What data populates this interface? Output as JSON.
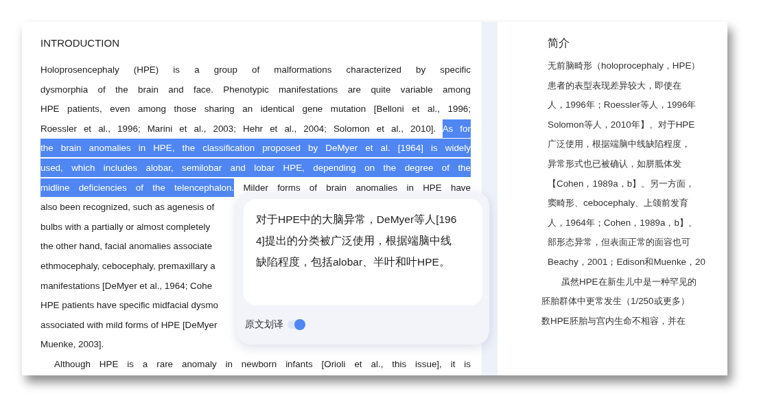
{
  "left_page": {
    "heading": "INTRODUCTION",
    "lines": [
      {
        "kind": "justified",
        "segments": [
          {
            "text": "Holoprosencephaly (HPE) is a group of malformations characterized by specific",
            "selected": false
          }
        ]
      },
      {
        "kind": "justified",
        "segments": [
          {
            "text": "dysmorphia of the brain and face. Phenotypic manifestations are quite variable among",
            "selected": false
          }
        ]
      },
      {
        "kind": "justified",
        "segments": [
          {
            "text": "HPE patients, even among those sharing an identical gene mutation [Belloni et al., 1996;",
            "selected": false
          }
        ]
      },
      {
        "kind": "justified",
        "segments": [
          {
            "text": "Roessler et al., 1996; Marini et al., 2003; Hehr et al., 2004; Solomon et al., 2010]. ",
            "selected": false
          },
          {
            "text": "As for",
            "selected": true
          }
        ]
      },
      {
        "kind": "justified",
        "segments": [
          {
            "text": "the brain anomalies in HPE, the classification proposed by DeMyer et al. [1964] is widely",
            "selected": true
          }
        ]
      },
      {
        "kind": "justified",
        "segments": [
          {
            "text": "used, which includes alobar, semilobar and lobar HPE, depending on the degree of the",
            "selected": true
          }
        ]
      },
      {
        "kind": "justified",
        "segments": [
          {
            "text": "midline deficiencies of the telencephalon.",
            "selected": true
          },
          {
            "text": " Milder forms of brain anomalies in HPE have",
            "selected": false
          }
        ]
      },
      {
        "kind": "cut",
        "segments": [
          {
            "text": "also been recognized, such as agenesis of",
            "selected": false
          }
        ]
      },
      {
        "kind": "cut",
        "segments": [
          {
            "text": "bulbs with a partially or almost completely",
            "selected": false
          }
        ]
      },
      {
        "kind": "cut",
        "segments": [
          {
            "text": "the other hand, facial anomalies associate",
            "selected": false
          }
        ]
      },
      {
        "kind": "cut",
        "segments": [
          {
            "text": "ethmocephaly, cebocephaly, premaxillary a",
            "selected": false
          }
        ]
      },
      {
        "kind": "cut",
        "segments": [
          {
            "text": "manifestations [DeMyer et al., 1964; Cohe",
            "selected": false
          }
        ]
      },
      {
        "kind": "cut",
        "segments": [
          {
            "text": "HPE patients have specific midfacial dysmo",
            "selected": false
          }
        ]
      },
      {
        "kind": "cut",
        "segments": [
          {
            "text": "associated with mild forms of HPE [DeMyer",
            "selected": false
          }
        ]
      },
      {
        "kind": "cut",
        "segments": [
          {
            "text": "Muenke, 2003].",
            "selected": false
          }
        ]
      },
      {
        "kind": "indent",
        "segments": [
          {
            "text": "Although HPE is a rare anomaly in newborn infants [Orioli et al., this issue], it is",
            "selected": false
          }
        ]
      }
    ]
  },
  "right_page": {
    "heading": "简介",
    "lines": [
      {
        "kind": "plain",
        "text": "无前脑畸形（holoprocephaly，HPE）"
      },
      {
        "kind": "plain",
        "text": "患者的表型表现差异较大，即使在"
      },
      {
        "kind": "plain",
        "text": "人，1996年；Roessler等人，1996年"
      },
      {
        "kind": "plain",
        "text": "Solomon等人，2010年】。对于HPE"
      },
      {
        "kind": "plain",
        "text": "广泛使用，根据端脑中线缺陷程度，"
      },
      {
        "kind": "plain",
        "text": "异常形式也已被确认，如胼胝体发"
      },
      {
        "kind": "plain",
        "text": "【Cohen，1989a，b】。另一方面，"
      },
      {
        "kind": "plain",
        "text": "窦畸形、cebocephaly、上颌前发育"
      },
      {
        "kind": "plain",
        "text": "人，1964年；Cohen，1989a，b】。"
      },
      {
        "kind": "plain",
        "text": "部形态异常，但表面正常的面容也可"
      },
      {
        "kind": "plain",
        "text": "Beachy，2001；Edison和Muenke，20"
      },
      {
        "kind": "indent",
        "text": "虽然HPE在新生儿中是一种罕见的"
      },
      {
        "kind": "flush",
        "text": "胚胎群体中更常发生（1/250或更多）"
      },
      {
        "kind": "flush",
        "text": "数HPE胚胎与宫内生命不相容，并在"
      }
    ]
  },
  "popup": {
    "translation": "对于HPE中的大脑异常，DeMyer等人[1964]提出的分类被广泛使用，根据端脑中线缺陷程度，包括alobar、半叶和叶HPE。",
    "toggle": {
      "label": "原文划译",
      "on": true
    }
  }
}
